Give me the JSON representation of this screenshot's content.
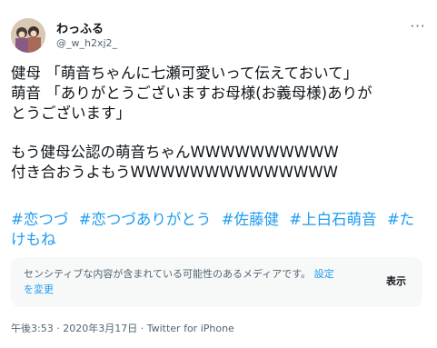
{
  "user": {
    "display_name": "わっふる",
    "handle": "@_w_h2xj2_"
  },
  "more_label": "···",
  "tweet": {
    "lines": [
      "健母 「萌音ちゃんに七瀬可愛いって伝えておいて」",
      "萌音 「ありがとうございますお母様(お義母様)ありが",
      "とうございます」",
      "もう健母公認の萌音ちゃんWWWWWWWWWW",
      "付き合おうよもうWWWWWWWWWWWWWW"
    ],
    "hashtags_line1": [
      "#恋つづ",
      "#恋つづありがとう",
      "#佐藤健",
      "#上白石萌音",
      "#た"
    ],
    "hashtags_line2": "けもね"
  },
  "sensitive": {
    "text": "センシティブな内容が含まれている可能性のあるメディアです。",
    "settings_link_1": "設定",
    "settings_link_2": "を変更",
    "show_button": "表示"
  },
  "meta": {
    "time": "午後3:53",
    "separator": " · ",
    "date": "2020年3月17日",
    "app": "Twitter for iPhone"
  }
}
